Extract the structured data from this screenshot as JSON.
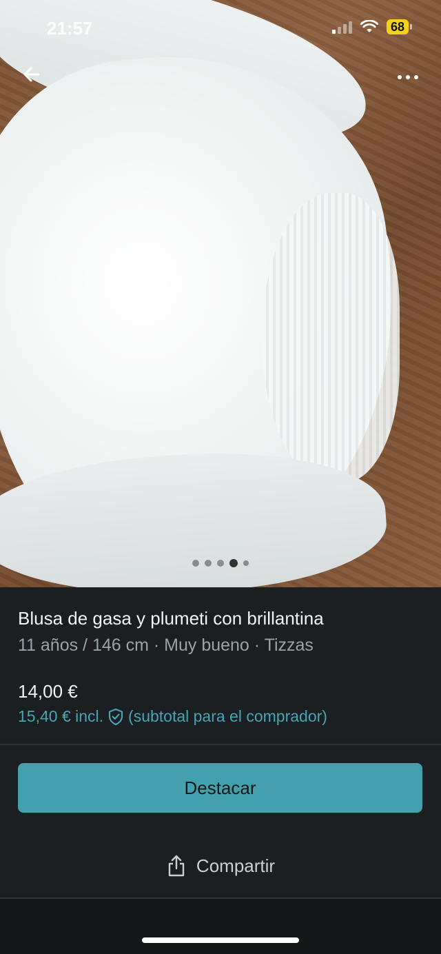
{
  "status_bar": {
    "time": "21:57",
    "battery": "68"
  },
  "nav": {
    "back_icon": "arrow-left-icon",
    "more_icon": "more-horizontal-icon"
  },
  "photo": {
    "image_count": 5,
    "active_index": 3
  },
  "listing": {
    "title": "Blusa de gasa y plumeti con brillantina",
    "subtitle": "11 años / 146 cm · Muy bueno · Tizzas",
    "price": "14,00 €",
    "price_incl": "15,40 € incl.",
    "buyer_note": "(subtotal para el comprador)"
  },
  "actions": {
    "feature_label": "Destacar",
    "share_label": "Compartir"
  },
  "colors": {
    "accent": "#45a0ad",
    "background": "#1b1f21",
    "battery": "#f2d21c"
  }
}
